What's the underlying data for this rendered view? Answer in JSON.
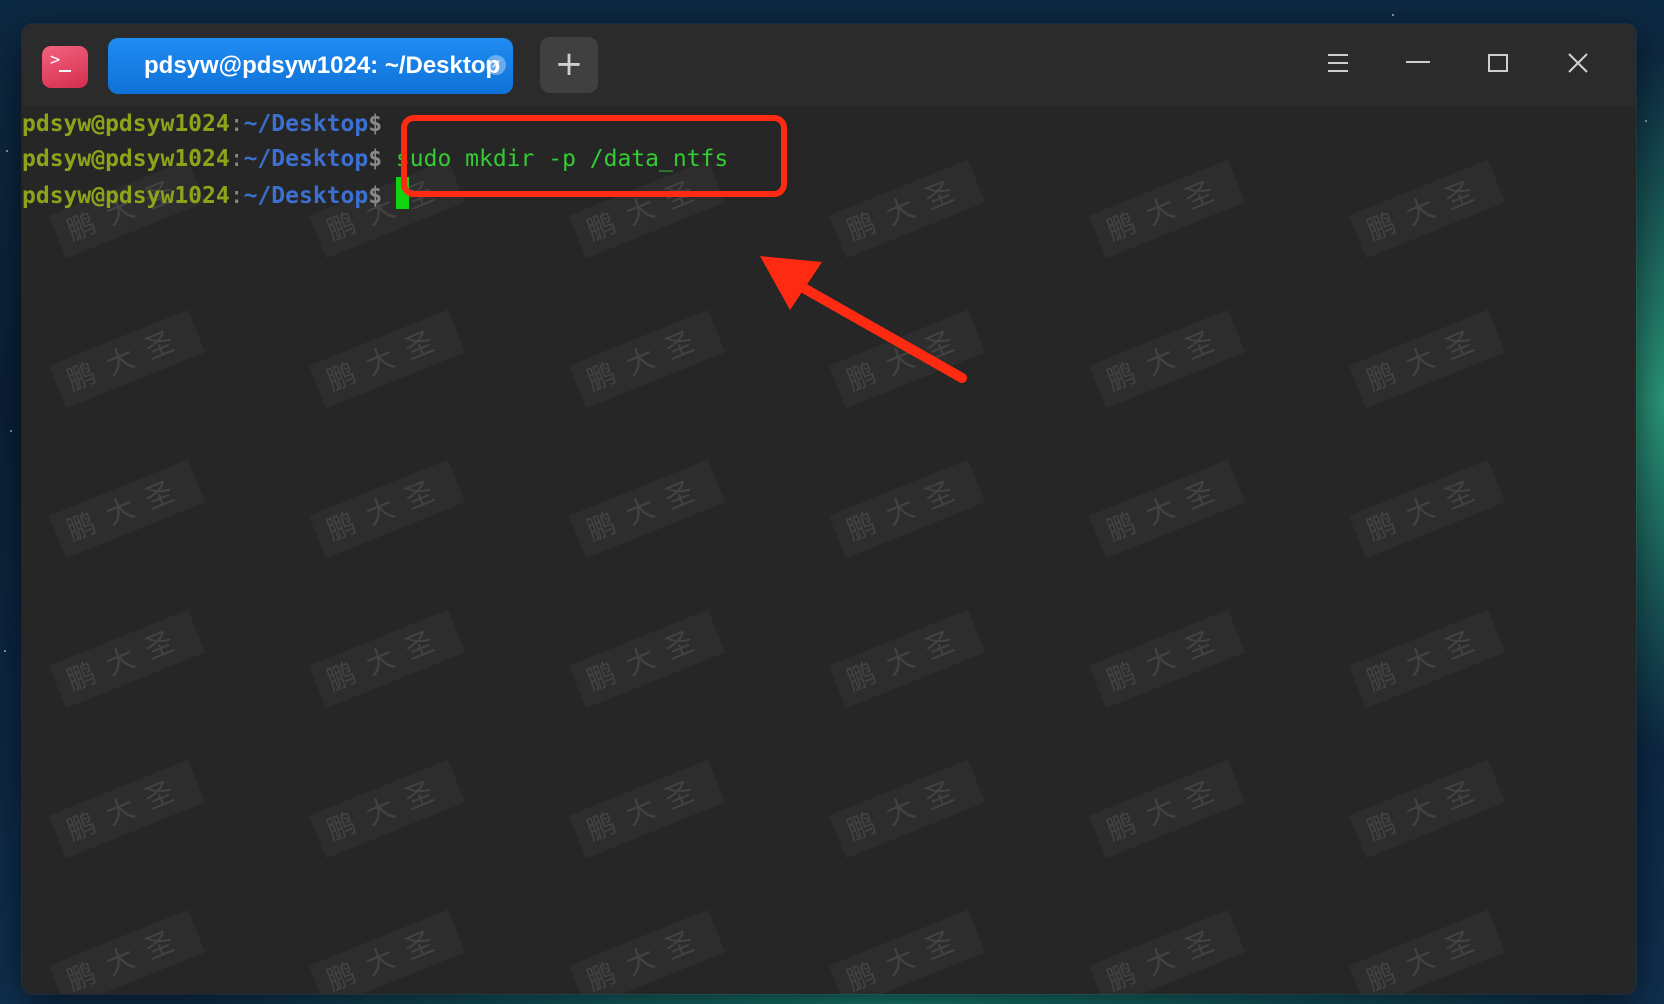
{
  "window": {
    "app_icon": "terminal-icon",
    "tab": {
      "label": "pdsyw@pdsyw1024: ~/Desktop",
      "close_icon": "close-icon",
      "close_glyph": "×"
    },
    "new_tab_glyph": "+",
    "controls": [
      "menu-icon",
      "minimize-icon",
      "maximize-icon",
      "close-icon"
    ]
  },
  "terminal": {
    "lines": [
      {
        "user": "pdsyw@pdsyw1024",
        "sep": ":",
        "path": "~/Desktop",
        "dollar": "$",
        "command": ""
      },
      {
        "user": "pdsyw@pdsyw1024",
        "sep": ":",
        "path": "~/Desktop",
        "dollar": "$",
        "command": " sudo mkdir -p /data_ntfs"
      },
      {
        "user": "pdsyw@pdsyw1024",
        "sep": ":",
        "path": "~/Desktop",
        "dollar": "$",
        "command": ""
      }
    ]
  },
  "watermark_text": "鹏大圣",
  "colors": {
    "tab_active": "#1a84ec",
    "prompt_user": "#8fa31a",
    "prompt_path": "#3b6fd1",
    "command": "#33cc33",
    "cursor": "#11d411",
    "annotation": "#ff2a12",
    "terminal_bg": "#262626"
  }
}
